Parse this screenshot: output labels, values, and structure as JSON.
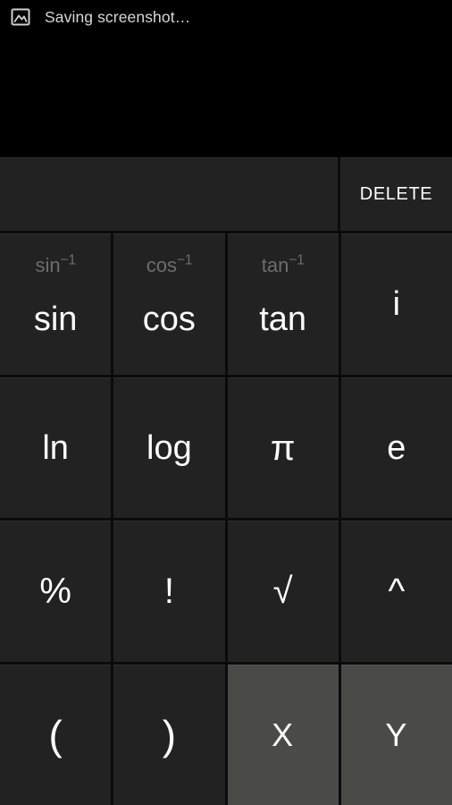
{
  "status": {
    "icon": "image-icon",
    "message": "Saving screenshot…"
  },
  "calculator": {
    "display": {
      "value": "",
      "placeholder": ""
    },
    "delete_label": "DELETE",
    "colors": {
      "background": "#000000",
      "key_dark": "#222222",
      "key_light": "#4a4a47",
      "text_primary": "#ffffff",
      "text_secondary": "#6d6d6d"
    },
    "rows": [
      {
        "keys": [
          {
            "label": "sin",
            "secondary": "sin",
            "secondary_sup": "−1",
            "style": "dark"
          },
          {
            "label": "cos",
            "secondary": "cos",
            "secondary_sup": "−1",
            "style": "dark"
          },
          {
            "label": "tan",
            "secondary": "tan",
            "secondary_sup": "−1",
            "style": "dark"
          },
          {
            "label": "i",
            "secondary": "",
            "secondary_sup": "",
            "style": "dark"
          }
        ]
      },
      {
        "keys": [
          {
            "label": "ln",
            "secondary": "",
            "secondary_sup": "",
            "style": "dark"
          },
          {
            "label": "log",
            "secondary": "",
            "secondary_sup": "",
            "style": "dark"
          },
          {
            "label": "π",
            "secondary": "",
            "secondary_sup": "",
            "style": "dark"
          },
          {
            "label": "e",
            "secondary": "",
            "secondary_sup": "",
            "style": "dark"
          }
        ]
      },
      {
        "keys": [
          {
            "label": "%",
            "secondary": "",
            "secondary_sup": "",
            "style": "dark"
          },
          {
            "label": "!",
            "secondary": "",
            "secondary_sup": "",
            "style": "dark"
          },
          {
            "label": "√",
            "secondary": "",
            "secondary_sup": "",
            "style": "dark"
          },
          {
            "label": "^",
            "secondary": "",
            "secondary_sup": "",
            "style": "dark"
          }
        ]
      },
      {
        "keys": [
          {
            "label": "(",
            "secondary": "",
            "secondary_sup": "",
            "style": "dark"
          },
          {
            "label": ")",
            "secondary": "",
            "secondary_sup": "",
            "style": "dark"
          },
          {
            "label": "X",
            "secondary": "",
            "secondary_sup": "",
            "style": "light"
          },
          {
            "label": "Y",
            "secondary": "",
            "secondary_sup": "",
            "style": "light"
          }
        ]
      }
    ]
  }
}
